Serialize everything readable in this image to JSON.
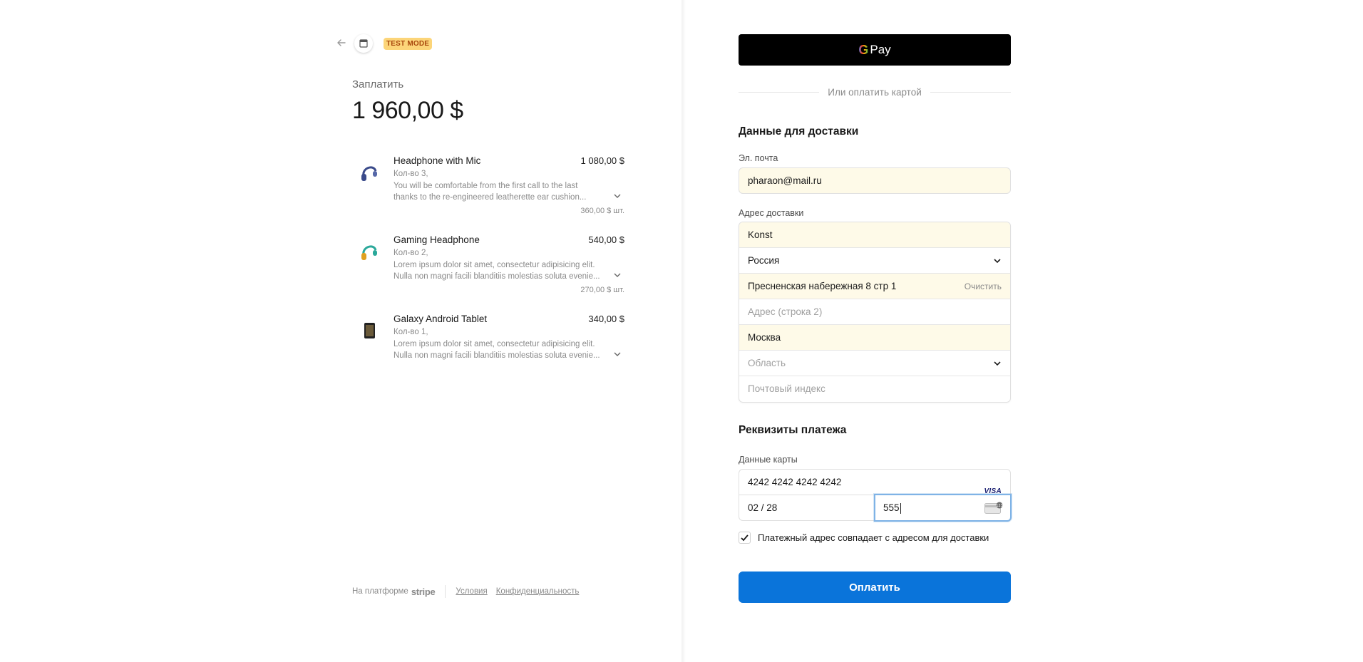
{
  "header": {
    "test_badge": "TEST MODE"
  },
  "summary": {
    "pay_label": "Заплатить",
    "amount": "1 960,00 $"
  },
  "items": [
    {
      "name": "Headphone with Mic",
      "price": "1 080,00 $",
      "qty": "Кол-во 3,",
      "desc_line1": "You will be comfortable from the first call to the last",
      "desc_line2": "thanks to the re-engineered leatherette ear cushion...",
      "unit_price": "360,00 $ шт.",
      "icon": "headphone-icon"
    },
    {
      "name": "Gaming Headphone",
      "price": "540,00 $",
      "qty": "Кол-во 2,",
      "desc_line1": "Lorem ipsum dolor sit amet, consectetur adipisicing elit.",
      "desc_line2": "Nulla non magni facili blanditiis molestias soluta evenie...",
      "unit_price": "270,00 $ шт.",
      "icon": "gaming-headphone-icon"
    },
    {
      "name": "Galaxy Android Tablet",
      "price": "340,00 $",
      "qty": "Кол-во 1,",
      "desc_line1": "Lorem ipsum dolor sit amet, consectetur adipisicing elit.",
      "desc_line2": "Nulla non magni facili blanditiis molestias soluta evenie...",
      "unit_price": "",
      "icon": "tablet-icon"
    }
  ],
  "footer": {
    "powered_by": "На платформе",
    "brand": "stripe",
    "terms": "Условия",
    "privacy": "Конфиденциальность"
  },
  "payment": {
    "gpay_label": "Pay",
    "gpay_g": "G",
    "or_card": "Или оплатить картой"
  },
  "shipping": {
    "title": "Данные для доставки",
    "email_label": "Эл. почта",
    "email_value": "pharaon@mail.ru",
    "address_label": "Адрес доставки",
    "name_value": "Konst",
    "country_value": "Россия",
    "line1_value": "Пресненская набережная 8 стр 1",
    "clear_label": "Очистить",
    "line2_placeholder": "Адрес (строка 2)",
    "city_value": "Москва",
    "region_placeholder": "Область",
    "postal_placeholder": "Почтовый индекс"
  },
  "billing": {
    "title": "Реквизиты платежа",
    "card_label": "Данные карты",
    "card_number": "4242 4242 4242 4242",
    "card_brand": "VISA",
    "expiry": "02 / 28",
    "cvc": "555",
    "same_address_label": "Платежный адрес совпадает с адресом для доставки",
    "same_address_checked": true
  },
  "submit_label": "Оплатить",
  "colors": {
    "accent": "#0a74da",
    "test_badge_bg": "#fcd579",
    "test_badge_text": "#a8470c",
    "autofill_bg": "#fefae8"
  }
}
